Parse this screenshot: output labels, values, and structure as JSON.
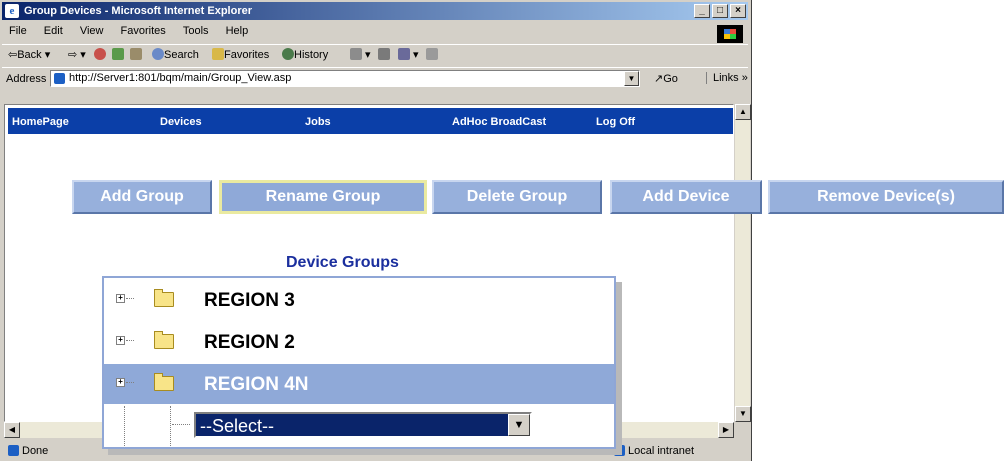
{
  "window": {
    "title": "Group Devices - Microsoft Internet Explorer",
    "controls": {
      "minimize": "_",
      "maximize": "□",
      "close": "×"
    }
  },
  "menu": [
    "File",
    "Edit",
    "View",
    "Favorites",
    "Tools",
    "Help"
  ],
  "toolbar": {
    "back": "⇦Back",
    "forward": "⇨",
    "search": "Search",
    "favorites": "Favorites",
    "history": "History"
  },
  "address": {
    "label": "Address",
    "url": "http://Server1:801/bqm/main/Group_View.asp",
    "go": "Go",
    "links": "Links »"
  },
  "nav": [
    "HomePage",
    "Devices",
    "Jobs",
    "AdHoc BroadCast",
    "Log Off"
  ],
  "actions": [
    "Add Group",
    "Rename Group",
    "Delete Group",
    "Add Device",
    "Remove Device(s)"
  ],
  "selected_action": "Rename Group",
  "device_groups": {
    "title": "Device Groups",
    "items": [
      {
        "label": "REGION 3",
        "selected": false
      },
      {
        "label": "REGION 2",
        "selected": false
      },
      {
        "label": "REGION 4N",
        "selected": true
      }
    ],
    "select": {
      "value": "--Select--"
    }
  },
  "status": {
    "left": "Done",
    "zone": "Local intranet"
  },
  "colors": {
    "nav_bg": "#0b3fa8",
    "button_bg": "#97b0dc",
    "selected_row": "#8fa9d8",
    "heading": "#1b2f9e",
    "selected_button_border": "#eaeaa0"
  }
}
